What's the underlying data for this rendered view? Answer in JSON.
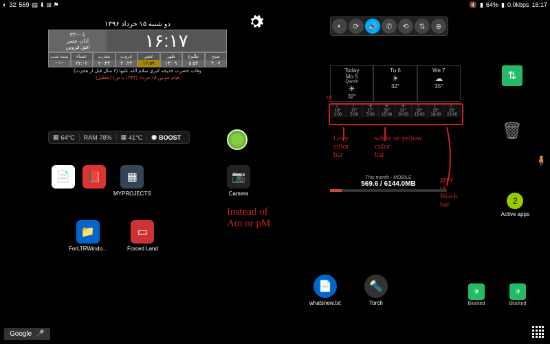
{
  "statusbar": {
    "left": {
      "num1": "32",
      "num2": "569"
    },
    "right": {
      "net": "0.0kbps",
      "battery": "64%",
      "time": "16:17"
    }
  },
  "persian": {
    "date": "دو شنبه ۱۵ خرداد ۱۳۹۶",
    "info1": "تا  --:۳۳",
    "info2": "اذان عصر",
    "info3": "افق:قزوین",
    "clock": "۱۶:۱۷",
    "cols": [
      {
        "h": "نیمه شب",
        "v": "--:--"
      },
      {
        "h": "عشاء",
        "v": "۲۲:۰۲"
      },
      {
        "h": "مغرب",
        "v": "۲۰:۴۳"
      },
      {
        "h": "غروب",
        "v": "۲۰:۲۳"
      },
      {
        "h": "عصر",
        "v": "۱۶:۵۹",
        "hl": true
      },
      {
        "h": "ظهر",
        "v": "۱۳:۰۹"
      },
      {
        "h": "طلوع",
        "v": "۵:۵۳"
      },
      {
        "h": "صبح",
        "v": "۴:۰۷"
      }
    ],
    "foot1": "وفات حضرت خدیجه کبری سلام الله علیها (۳ سال قبل از هجرت)",
    "foot2": "قیام خونین ۱۵ خرداد (۱۳۴۲ ه ش) (تعطیل)"
  },
  "booster": {
    "cpu": "64°C",
    "ram": "78%",
    "temp": "41°C",
    "boost": "BOOST"
  },
  "weather": {
    "days": [
      {
        "lbl": "Today",
        "sub": "Mo 5",
        "loc": "Qazvin",
        "t": "32°",
        "ico": "☀"
      },
      {
        "lbl": "Tu 6",
        "t": "32°",
        "ico": "☀"
      },
      {
        "lbl": "We 7",
        "t": "35°",
        "ico": "☁"
      }
    ],
    "hours": [
      {
        "t": "19°",
        "h": "1:00",
        "i": "☾"
      },
      {
        "t": "17°",
        "h": "5:00",
        "i": "☾"
      },
      {
        "t": "17°",
        "h": "5:00",
        "i": "☀"
      },
      {
        "t": "32°",
        "h": "15:00",
        "i": "☀"
      },
      {
        "t": "32°",
        "h": "20:00",
        "i": "☀"
      },
      {
        "t": "32°",
        "h": "15:00",
        "i": "☾"
      },
      {
        "t": "23°",
        "h": "18:00",
        "i": "☾"
      },
      {
        "t": "23°",
        "h": "23:00",
        "i": "☾"
      }
    ]
  },
  "data": {
    "hdr": "This month - MOBILE",
    "val": "569.6 / 6144.0MB"
  },
  "apps": {
    "myprojects": "MYPROJECTS",
    "camera": "Camera",
    "forltr": "ForLTRWindo...",
    "forced": "Forced Land",
    "whatsnew": "whatsnew.txt",
    "torch": "Torch",
    "blocked": "Blocked",
    "activeapps": "Active apps",
    "activecount": "2"
  },
  "annotations": {
    "or": "or",
    "grey": "Grey\ncolor\nbar",
    "white": "white or yellow\ncolor\nbar",
    "greyblack": "grey\nor\nBlack\nbar",
    "instead": "Instead of\nAm or pM"
  },
  "google": "Google"
}
